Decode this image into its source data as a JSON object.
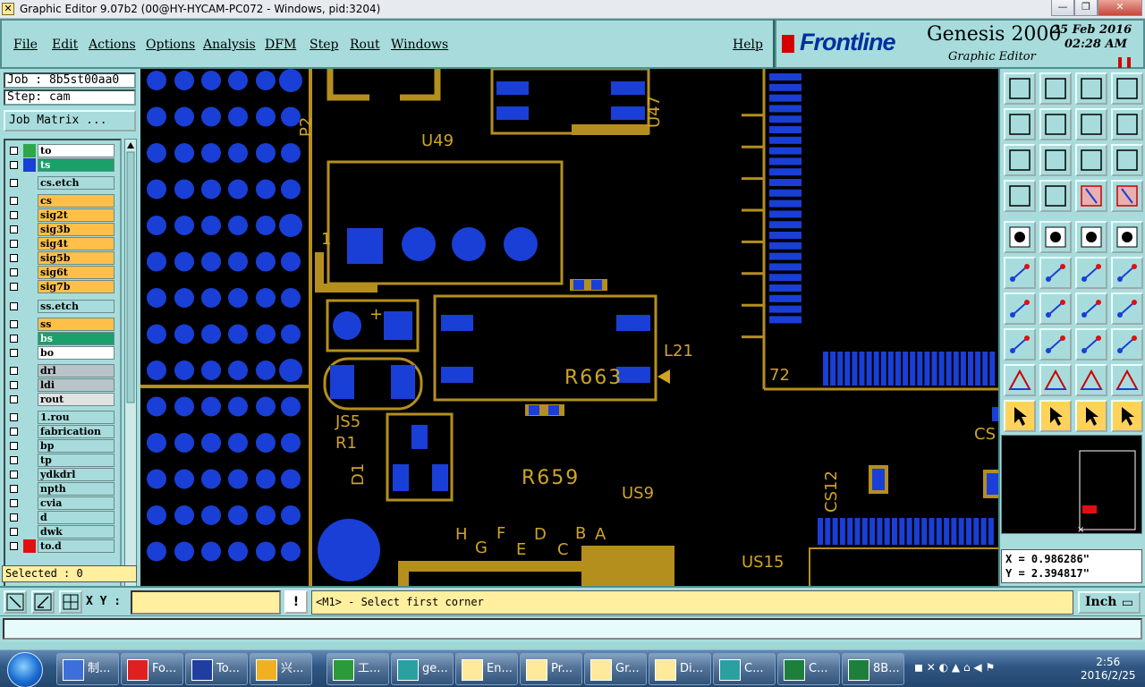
{
  "window": {
    "title": "Graphic Editor 9.07b2 (00@HY-HYCAM-PC072 - Windows, pid:3204)",
    "min": "—",
    "max": "❐",
    "close": "✕"
  },
  "menu": {
    "items": [
      "File",
      "Edit",
      "Actions",
      "Options",
      "Analysis",
      "DFM",
      "Step",
      "Rout",
      "Windows"
    ],
    "help": "Help"
  },
  "brand": {
    "logo": "Frontline",
    "product": "Genesis 2000",
    "subtitle": "Graphic Editor",
    "date": "25 Feb 2016",
    "time": "02:28 AM",
    "paused": "❚❚"
  },
  "job": {
    "job_label": "Job : 8b5st00aa0",
    "step_label": "Step: cam",
    "matrix_button": "Job Matrix ..."
  },
  "layers": [
    {
      "name": "to",
      "color": "#2fa64a",
      "swatch": "#2fa64a",
      "bg": "#ffffff",
      "active": true
    },
    {
      "name": "ts",
      "color": "#1a3fd6",
      "swatch": "#1a3fd6",
      "bg": "#1aa06a"
    },
    {
      "name": "cs.etch",
      "color": "#a8dcdc",
      "bg": "#a8dcdc"
    },
    {
      "name": "cs",
      "bg": "#ffc04a"
    },
    {
      "name": "sig2t",
      "bg": "#ffc04a"
    },
    {
      "name": "sig3b",
      "bg": "#ffc04a"
    },
    {
      "name": "sig4t",
      "bg": "#ffc04a"
    },
    {
      "name": "sig5b",
      "bg": "#ffc04a"
    },
    {
      "name": "sig6t",
      "bg": "#ffc04a"
    },
    {
      "name": "sig7b",
      "bg": "#ffc04a"
    },
    {
      "name": "ss.etch",
      "bg": "#a8dcdc"
    },
    {
      "name": "ss",
      "bg": "#ffc04a"
    },
    {
      "name": "bs",
      "bg": "#1aa06a"
    },
    {
      "name": "bo",
      "bg": "#ffffff"
    },
    {
      "name": "drl",
      "bg": "#b9c4c8"
    },
    {
      "name": "ldi",
      "bg": "#b9c4c8"
    },
    {
      "name": "rout",
      "bg": "#e2e2e2"
    },
    {
      "name": "1.rou",
      "bg": "#a8dcdc"
    },
    {
      "name": "fabrication",
      "bg": "#a8dcdc"
    },
    {
      "name": "bp",
      "bg": "#a8dcdc"
    },
    {
      "name": "tp",
      "bg": "#a8dcdc"
    },
    {
      "name": "ydkdrl",
      "bg": "#a8dcdc"
    },
    {
      "name": "npth",
      "bg": "#a8dcdc"
    },
    {
      "name": "cvia",
      "bg": "#a8dcdc"
    },
    {
      "name": "d",
      "bg": "#a8dcdc"
    },
    {
      "name": "dwk",
      "bg": "#a8dcdc"
    },
    {
      "name": "to.d",
      "swatch": "#e01010",
      "bg": "#a8dcdc"
    }
  ],
  "selected": "Selected : 0",
  "canvas_labels": [
    "P2",
    "U49",
    "U47",
    "L21",
    "R663",
    "72",
    "JS5",
    "R1",
    "D1",
    "R659",
    "US9",
    "CS12",
    "CS",
    "H",
    "G",
    "F",
    "E",
    "D",
    "C",
    "B",
    "A",
    "US15",
    "1"
  ],
  "coords": {
    "x": "X = 0.986286\"",
    "y": "Y = 2.394817\""
  },
  "command": {
    "xy_label": "X Y :",
    "xy_value": "",
    "alert": "!",
    "message": "<M1> - Select first corner",
    "unit": "Inch"
  },
  "status_line": "",
  "taskbar": {
    "tasks": [
      {
        "label": "制...",
        "color": "#3c6fd8"
      },
      {
        "label": "Fo...",
        "color": "#e02020"
      },
      {
        "label": "To...",
        "color": "#203ea0"
      },
      {
        "label": "兴...",
        "color": "#f0b020"
      },
      {
        "label": "工...",
        "color": "#2b9b3a"
      },
      {
        "label": "ge...",
        "color": "#2aa0a0"
      },
      {
        "label": "En...",
        "color": "#ffe99a"
      },
      {
        "label": "Pr...",
        "color": "#ffe99a"
      },
      {
        "label": "Gr...",
        "color": "#ffe99a"
      },
      {
        "label": "Di...",
        "color": "#ffe99a"
      },
      {
        "label": "C...",
        "color": "#2aa0a0"
      },
      {
        "label": "C...",
        "color": "#1e7f3c"
      },
      {
        "label": "8B...",
        "color": "#1e7f3c"
      }
    ],
    "clock_time": "2:56",
    "clock_date": "2016/2/25"
  }
}
